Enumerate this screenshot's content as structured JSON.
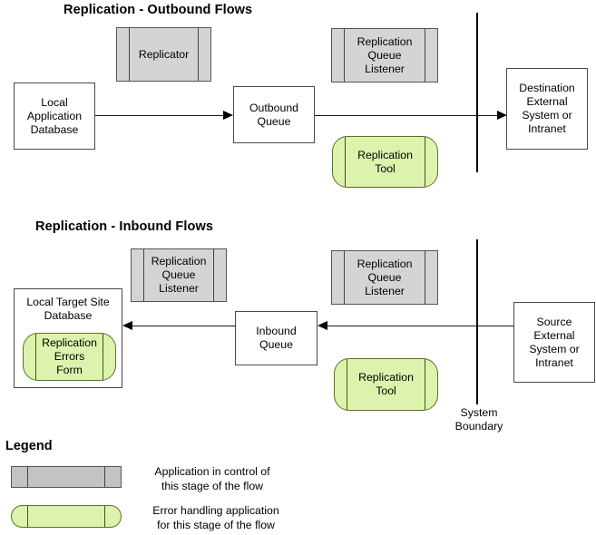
{
  "sections": {
    "outbound": {
      "title": "Replication - Outbound Flows"
    },
    "inbound": {
      "title": "Replication - Inbound Flows"
    }
  },
  "nodes": {
    "replicator": "Replicator",
    "local_application_database": "Local\nApplication\nDatabase",
    "outbound_queue": "Outbound\nQueue",
    "replication_queue_listener_outbound": "Replication\nQueue\nListener",
    "replication_tool_outbound": "Replication\nTool",
    "destination_external_system": "Destination\nExternal\nSystem or\nIntranet",
    "local_target_site_database": "Local Target Site\nDatabase",
    "replication_errors_form": "Replication\nErrors\nForm",
    "replication_queue_listener_inbound_left": "Replication\nQueue\nListener",
    "replication_queue_listener_inbound_right": "Replication\nQueue\nListener",
    "inbound_queue": "Inbound\nQueue",
    "replication_tool_inbound": "Replication\nTool",
    "source_external_system": "Source\nExternal\nSystem or\nIntranet"
  },
  "boundary": {
    "label": "System\nBoundary"
  },
  "legend": {
    "title": "Legend",
    "items": [
      {
        "swatch": "gray-component",
        "text": "Application in control of\nthis stage of the flow",
        "color": "#c3c3c3"
      },
      {
        "swatch": "green-error-handler",
        "text": "Error handling application\nfor this stage of the flow",
        "color": "#ddf2ac"
      }
    ]
  },
  "colors": {
    "component_fill": "#d4d4d4",
    "error_app_fill": "#ddf2ac",
    "node_stroke": "#4a4a4a",
    "connector": "#000000",
    "background": "#ffffff"
  }
}
